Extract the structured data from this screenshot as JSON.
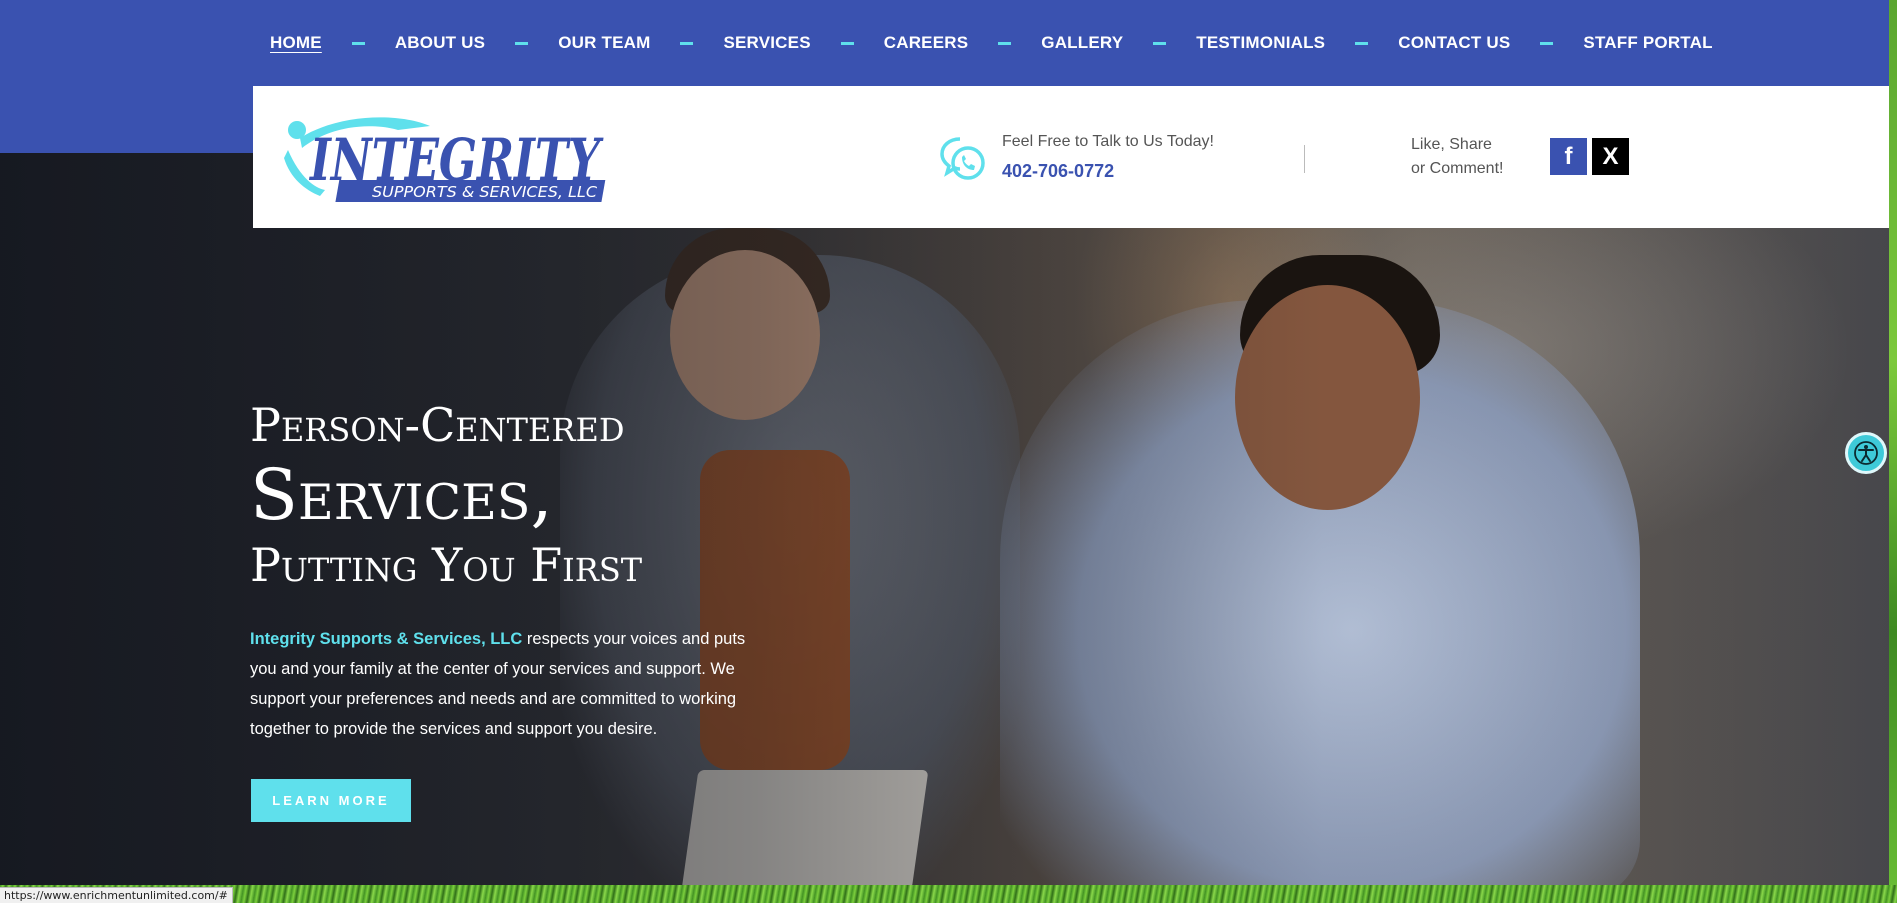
{
  "nav": {
    "items": [
      {
        "label": "HOME"
      },
      {
        "label": "ABOUT US"
      },
      {
        "label": "OUR TEAM"
      },
      {
        "label": "SERVICES"
      },
      {
        "label": "CAREERS"
      },
      {
        "label": "GALLERY"
      },
      {
        "label": "TESTIMONIALS"
      },
      {
        "label": "CONTACT US"
      },
      {
        "label": "STAFF PORTAL"
      }
    ],
    "active": "HOME"
  },
  "header": {
    "logo_word": "INTEGRITY",
    "logo_sub": "SUPPORTS & SERVICES, LLC",
    "talk_label": "Feel Free to Talk to Us Today!",
    "phone": "402-706-0772",
    "social_label_1": "Like, Share",
    "social_label_2": "or Comment!",
    "facebook_glyph": "f",
    "x_glyph": "X"
  },
  "hero": {
    "line1": "Person-Centered",
    "line2": "Services,",
    "line3": "Putting You First",
    "brand": "Integrity Supports & Services, LLC",
    "body": " respects your voices and puts you and your family at the center of your services and support. We support your preferences and needs and are committed to working together to provide the services and support you desire.",
    "button": "LEARN MORE"
  },
  "status_url": "https://www.enrichmentunlimited.com/#",
  "colors": {
    "brand_blue": "#3a52b0",
    "accent_cyan": "#5fe0ec"
  },
  "icons": [
    "phone-chat-icon",
    "facebook-icon",
    "x-icon",
    "accessibility-icon"
  ]
}
